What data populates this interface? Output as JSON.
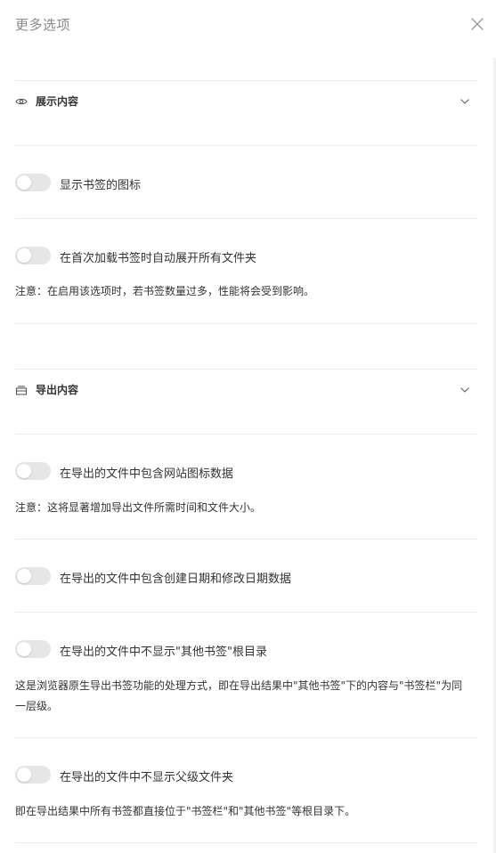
{
  "header": {
    "title": "更多选项"
  },
  "sections": {
    "display": {
      "title": "展示内容"
    },
    "export": {
      "title": "导出内容"
    }
  },
  "options": {
    "show_icon": {
      "label": "显示书签的图标",
      "enabled": false
    },
    "expand_all": {
      "label": "在首次加载书签时自动展开所有文件夹",
      "enabled": false,
      "note": "注意：在启用该选项时，若书签数量过多，性能将会受到影响。"
    },
    "include_favicon": {
      "label": "在导出的文件中包含网站图标数据",
      "enabled": false,
      "note": "注意：这将显著增加导出文件所需时间和文件大小。"
    },
    "include_dates": {
      "label": "在导出的文件中包含创建日期和修改日期数据",
      "enabled": false
    },
    "hide_other_bookmarks": {
      "label": "在导出的文件中不显示\"其他书签\"根目录",
      "enabled": false,
      "note": "这是浏览器原生导出书签功能的处理方式，即在导出结果中\"其他书签\"下的内容与\"书签栏\"为同一层级。"
    },
    "hide_parent_folder": {
      "label": "在导出的文件中不显示父级文件夹",
      "enabled": false,
      "note": "即在导出结果中所有书签都直接位于\"书签栏\"和\"其他书签\"等根目录下。"
    }
  },
  "colors": {
    "toggle_off": "#e6e6e6",
    "divider": "#ebebeb",
    "title_muted": "#8a8a8a",
    "text": "#333333"
  },
  "icons": {
    "close": "close-icon",
    "display_section": "eye-icon",
    "export_section": "archive-icon",
    "expand": "chevron-down-icon"
  }
}
